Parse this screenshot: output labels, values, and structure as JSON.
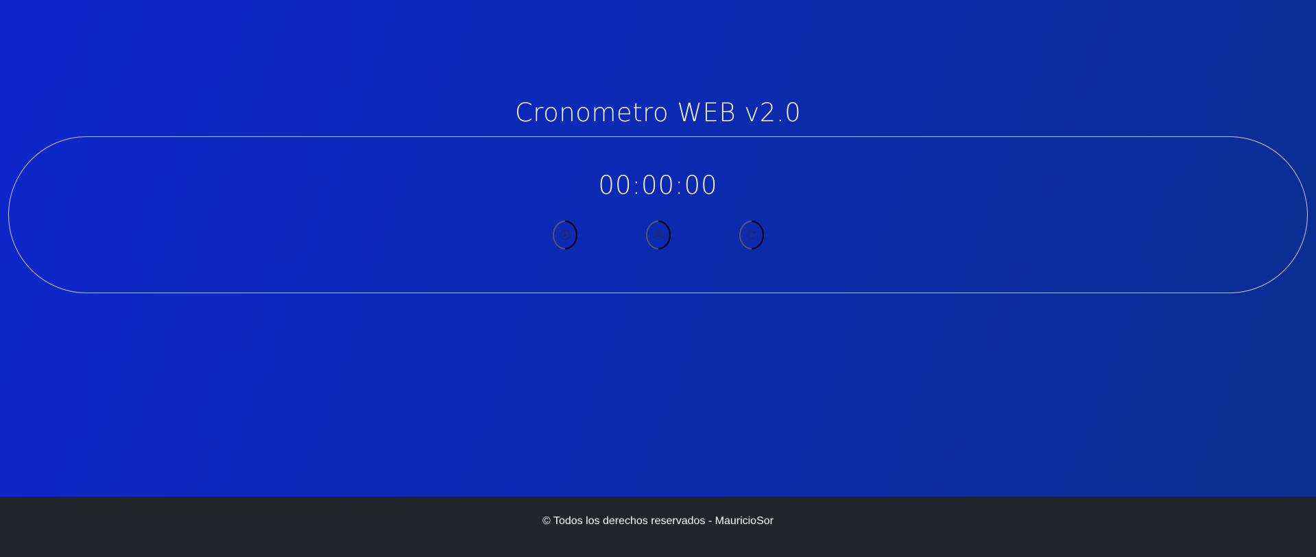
{
  "app": {
    "title": "Cronometro WEB v2.0"
  },
  "timer": {
    "display": "00:00:00"
  },
  "controls": [
    {
      "name": "play",
      "icon": "play-icon"
    },
    {
      "name": "pause",
      "icon": "pause-icon"
    },
    {
      "name": "reset",
      "icon": "reset-icon"
    }
  ],
  "footer": {
    "text": "© Todos los derechos reservados - MauricioSor"
  },
  "colors": {
    "background_start": "#0f26cc",
    "background_end": "#0b2f8f",
    "footer_background": "#212529",
    "text": "#ffffff"
  }
}
